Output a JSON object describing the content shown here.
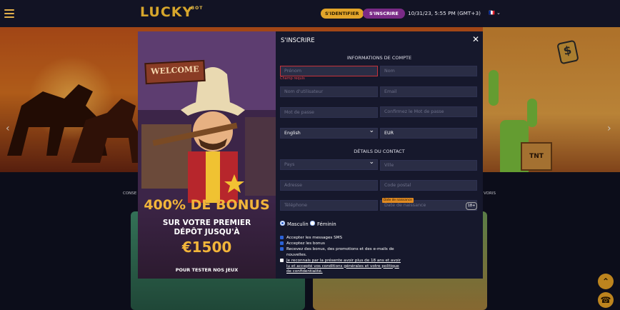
{
  "header": {
    "logo_text": "LUCKY",
    "logo_suffix": "BOT",
    "login_label": "S'IDENTIFIER",
    "signup_label": "S'INSCRIRE",
    "datetime": "10/31/23, 5:55 PM (GMT+3)",
    "language_flag": "🇫🇷 ⌄"
  },
  "page": {
    "category_left": "CONSE",
    "category_right": "VORIS",
    "tnt_label": "TNT"
  },
  "promo": {
    "welcome_sign": "WELCOME",
    "title": "400% DE BONUS",
    "line1": "SUR VOTRE PREMIER",
    "line2": "DÉPÔT JUSQU'À",
    "amount": "€1500",
    "cta": "POUR TESTER NOS JEUX"
  },
  "signup": {
    "title": "S'INSCRIRE",
    "section_account": "INFORMATIONS DE COMPTE",
    "first_name_placeholder": "Prénom",
    "required_error": "Champ requis",
    "last_name_placeholder": "Nom",
    "username_placeholder": "Nom d'utilisateur",
    "email_placeholder": "Email",
    "password_placeholder": "Mot de passe",
    "confirm_password_placeholder": "Confirmez le Mot de passe",
    "language_value": "English",
    "currency_value": "EUR",
    "section_contact": "DÉTAILS DU CONTACT",
    "country_placeholder": "Pays",
    "city_placeholder": "Ville",
    "address_placeholder": "Adresse",
    "postal_placeholder": "Code postal",
    "phone_placeholder": "Téléphone",
    "dob_placeholder": "Date de naissance",
    "dob_tag": "Date de naissance",
    "age_badge": "18+",
    "gender_male": "Masculin",
    "gender_female": "Féminin",
    "checkbox_sms": "Accepter les messages SMS",
    "checkbox_bonus": "Acceptez les bonus",
    "checkbox_promos": "Recevez des bonus, des promotions et des e-mails de nouvelles.",
    "checkbox_terms": "Je reconnais par la présente avoir plus de 18 ans et avoir lu et accepté vos conditions générales et votre politique de confidentialité."
  },
  "colors": {
    "accent": "#e3a52a",
    "signup": "#7a2a86",
    "error": "#e0444c",
    "checkbox": "#2c63d8"
  }
}
